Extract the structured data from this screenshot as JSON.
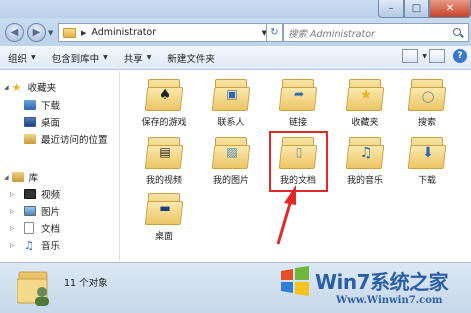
{
  "window": {
    "minimize": "–",
    "maximize": "□",
    "close": "✕"
  },
  "address": {
    "path": "Administrator",
    "search_placeholder": "搜索 Administrator"
  },
  "toolbar": {
    "organize": "组织",
    "include_in_library": "包含到库中",
    "share": "共享",
    "new_folder": "新建文件夹",
    "help": "?"
  },
  "nav": {
    "favorites": "收藏夹",
    "downloads": "下载",
    "desktop": "桌面",
    "recent": "最近访问的位置",
    "libraries": "库",
    "videos": "视频",
    "pictures": "图片",
    "documents": "文档",
    "music": "音乐"
  },
  "items": [
    {
      "label": "保存的游戏",
      "icon": "saved-games-icon"
    },
    {
      "label": "联系人",
      "icon": "contacts-icon"
    },
    {
      "label": "链接",
      "icon": "links-icon"
    },
    {
      "label": "收藏夹",
      "icon": "favorites-icon"
    },
    {
      "label": "搜索",
      "icon": "searches-icon"
    },
    {
      "label": "我的视频",
      "icon": "my-videos-icon"
    },
    {
      "label": "我的图片",
      "icon": "my-pictures-icon"
    },
    {
      "label": "我的文档",
      "icon": "my-documents-icon"
    },
    {
      "label": "我的音乐",
      "icon": "my-music-icon"
    },
    {
      "label": "下载",
      "icon": "downloads-icon"
    },
    {
      "label": "桌面",
      "icon": "desktop-folder-icon"
    }
  ],
  "status": {
    "count": "11 个对象"
  },
  "watermark": {
    "title": "Win7系统之家",
    "url": "Www.Winwin7.com"
  },
  "colors": {
    "accent": "#2b5fa5",
    "highlight": "#e02a2a",
    "folder": "#ecc566"
  }
}
